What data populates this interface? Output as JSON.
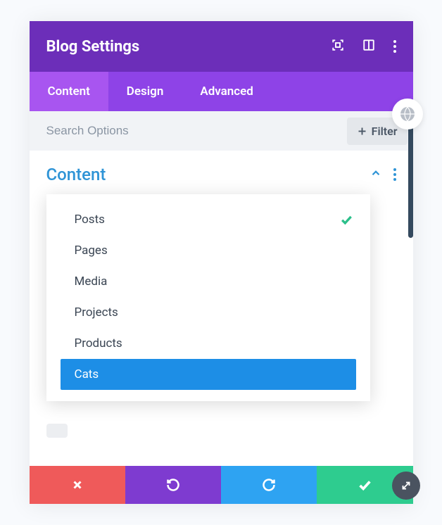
{
  "header": {
    "title": "Blog Settings"
  },
  "tabs": [
    {
      "label": "Content",
      "active": true
    },
    {
      "label": "Design",
      "active": false
    },
    {
      "label": "Advanced",
      "active": false
    }
  ],
  "search": {
    "placeholder": "Search Options",
    "filter_label": "Filter"
  },
  "section": {
    "title": "Content"
  },
  "dropdown": {
    "items": [
      {
        "label": "Posts",
        "selected": true,
        "highlighted": false
      },
      {
        "label": "Pages",
        "selected": false,
        "highlighted": false
      },
      {
        "label": "Media",
        "selected": false,
        "highlighted": false
      },
      {
        "label": "Projects",
        "selected": false,
        "highlighted": false
      },
      {
        "label": "Products",
        "selected": false,
        "highlighted": false
      },
      {
        "label": "Cats",
        "selected": false,
        "highlighted": true
      }
    ]
  },
  "colors": {
    "header": "#6c2eb9",
    "tabs": "#8e43e7",
    "tab_active": "#a855f0",
    "accent_blue": "#2f94d6",
    "highlight": "#1d8ee6",
    "green": "#2ecc8f",
    "red": "#ef5a5a"
  }
}
